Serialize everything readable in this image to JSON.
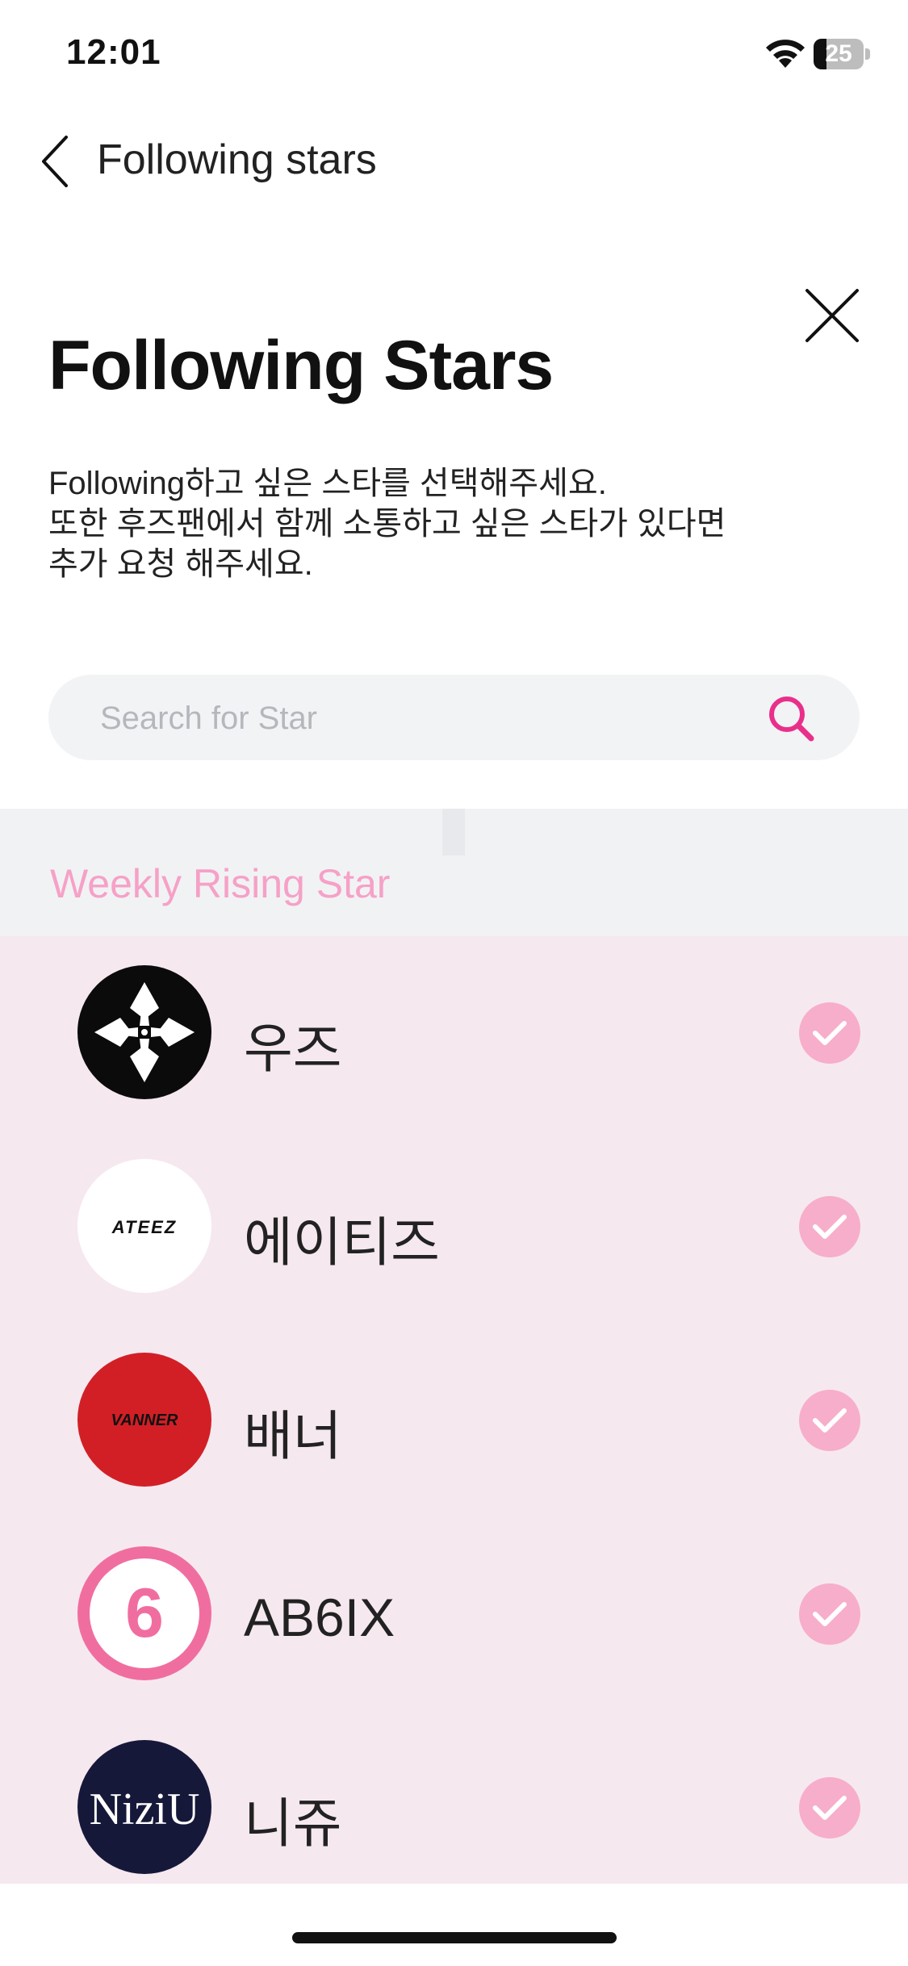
{
  "status_bar": {
    "time": "12:01",
    "battery": "25"
  },
  "nav": {
    "title": "Following stars"
  },
  "sheet": {
    "title": "Following Stars",
    "description": [
      "Following하고 싶은 스타를 선택해주세요.",
      "또한 후즈팬에서 함께 소통하고 싶은 스타가 있다면",
      "추가 요청 해주세요."
    ]
  },
  "search": {
    "placeholder": "Search for Star",
    "value": ""
  },
  "section": {
    "label": "Weekly Rising Star"
  },
  "stars": [
    {
      "name": "우즈",
      "logo_text": "",
      "selected": true
    },
    {
      "name": "에이티즈",
      "logo_text": "ATEEZ",
      "selected": true
    },
    {
      "name": "배너",
      "logo_text": "VANNER",
      "selected": true
    },
    {
      "name": "AB6IX",
      "logo_text": "6",
      "selected": true
    },
    {
      "name": "니쥬",
      "logo_text": "NiziU",
      "selected": true
    }
  ],
  "colors": {
    "accent": "#e8308b",
    "section_label": "#f6a1c7",
    "list_background": "#f6e8ef",
    "check_background": "#f7aeca"
  }
}
